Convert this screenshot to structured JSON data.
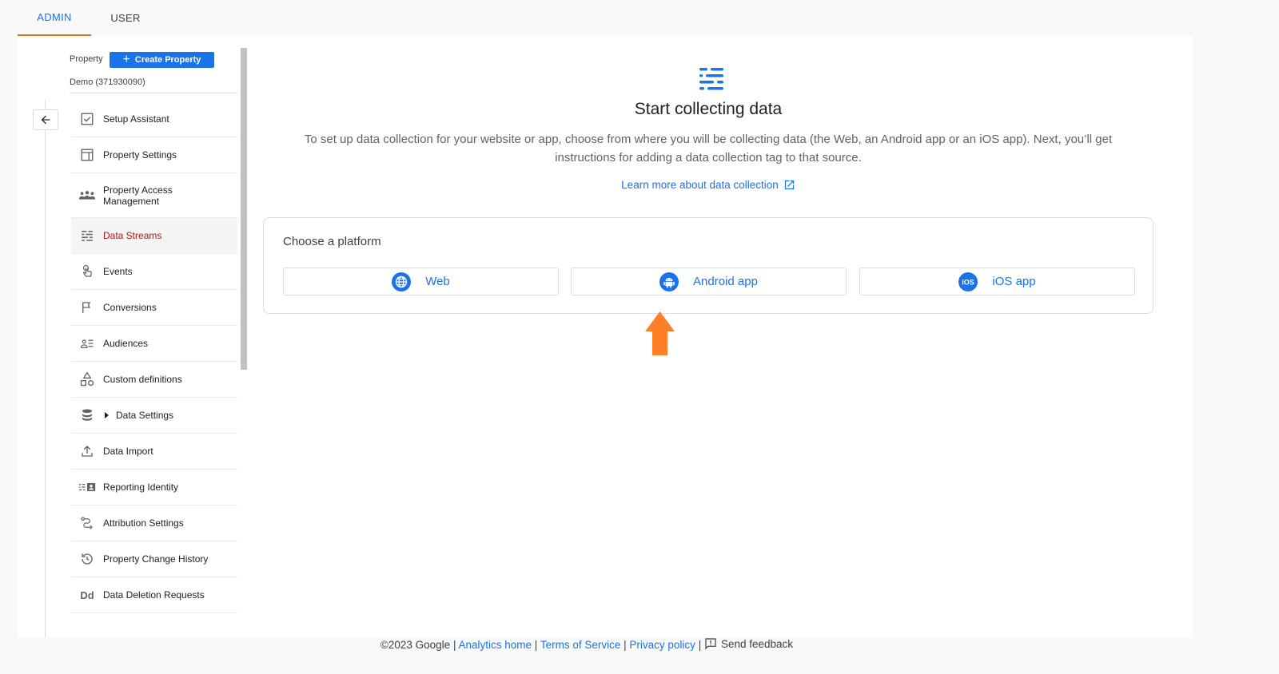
{
  "tabs": {
    "admin": "ADMIN",
    "user": "USER"
  },
  "property": {
    "label": "Property",
    "create_label": "Create Property",
    "name": "Demo (371930090)"
  },
  "nav": {
    "setup_assistant": "Setup Assistant",
    "property_settings": "Property Settings",
    "property_access_1": "Property Access",
    "property_access_2": "Management",
    "data_streams": "Data Streams",
    "events": "Events",
    "conversions": "Conversions",
    "audiences": "Audiences",
    "custom_definitions": "Custom definitions",
    "data_settings": "Data Settings",
    "data_import": "Data Import",
    "reporting_identity": "Reporting Identity",
    "attribution_settings": "Attribution Settings",
    "property_change_history": "Property Change History",
    "data_deletion_requests": "Data Deletion Requests",
    "dd_icon": "Dd"
  },
  "main": {
    "title": "Start collecting data",
    "description": "To set up data collection for your website or app, choose from where you will be collecting data (the Web, an Android app or an iOS app). Next, you’ll get instructions for adding a data collection tag to that source.",
    "learn_more": "Learn more about data collection",
    "choose_platform": "Choose a platform",
    "platforms": {
      "web": "Web",
      "android": "Android app",
      "ios": "iOS app",
      "ios_badge": "iOS"
    }
  },
  "footer": {
    "copyright": "©2023 Google",
    "analytics_home": "Analytics home",
    "terms": "Terms of Service",
    "privacy": "Privacy policy",
    "feedback": "Send feedback",
    "sep": "|"
  },
  "colors": {
    "accent": "#1a73e8",
    "active_nav": "#b31412",
    "tab_underline": "#e8710a",
    "arrow": "#ff7f27"
  }
}
